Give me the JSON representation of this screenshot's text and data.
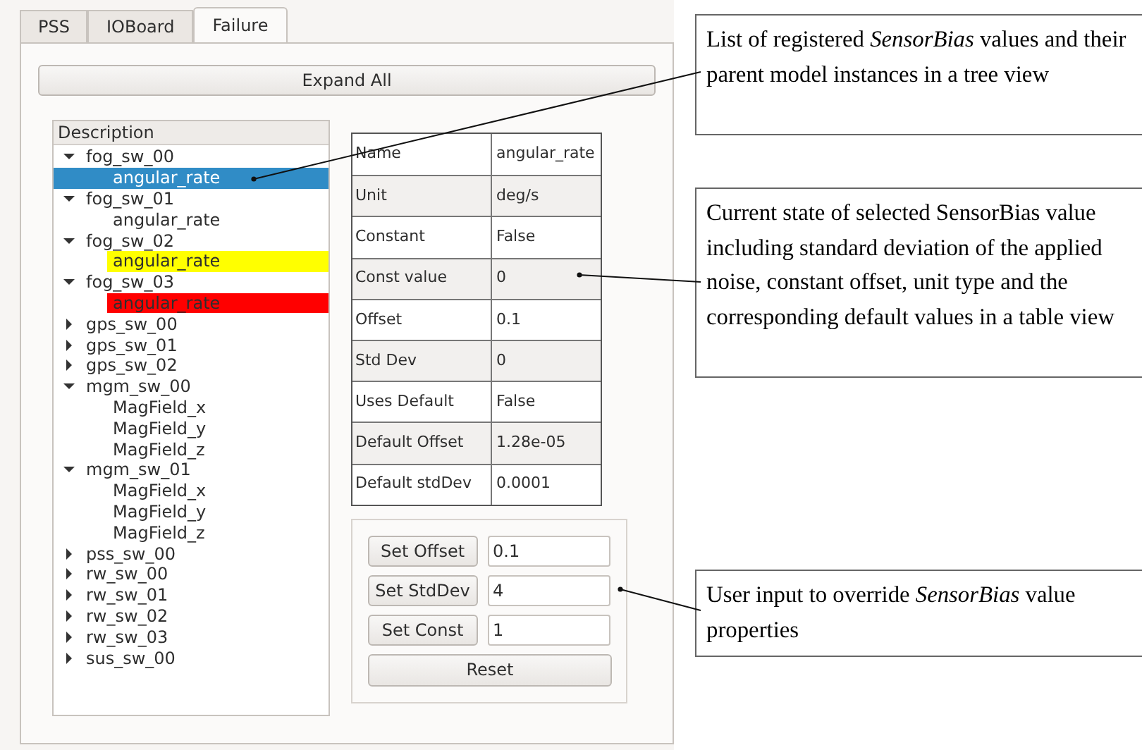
{
  "tabs": [
    {
      "label": "PSS",
      "selected": false
    },
    {
      "label": "IOBoard",
      "selected": false
    },
    {
      "label": "Failure",
      "selected": true
    }
  ],
  "expand_button": "Expand All",
  "tree": {
    "header": "Description",
    "items": [
      {
        "label": "fog_sw_00",
        "expanded": true,
        "selected": false,
        "children": [
          {
            "label": "angular_rate",
            "selected": true
          }
        ]
      },
      {
        "label": "fog_sw_01",
        "expanded": true,
        "selected": false,
        "children": [
          {
            "label": "angular_rate",
            "selected": false
          }
        ]
      },
      {
        "label": "fog_sw_02",
        "expanded": true,
        "selected": false,
        "children": [
          {
            "label": "angular_rate",
            "selected": false,
            "color": "#ffff00"
          }
        ]
      },
      {
        "label": "fog_sw_03",
        "expanded": true,
        "selected": false,
        "children": [
          {
            "label": "angular_rate",
            "selected": false,
            "color": "#ff0000"
          }
        ]
      },
      {
        "label": "gps_sw_00",
        "expanded": false,
        "selected": false
      },
      {
        "label": "gps_sw_01",
        "expanded": false,
        "selected": false
      },
      {
        "label": "gps_sw_02",
        "expanded": false,
        "selected": false
      },
      {
        "label": "mgm_sw_00",
        "expanded": true,
        "selected": false,
        "children": [
          {
            "label": "MagField_x",
            "selected": false
          },
          {
            "label": "MagField_y",
            "selected": false
          },
          {
            "label": "MagField_z",
            "selected": false
          }
        ]
      },
      {
        "label": "mgm_sw_01",
        "expanded": true,
        "selected": false,
        "children": [
          {
            "label": "MagField_x",
            "selected": false
          },
          {
            "label": "MagField_y",
            "selected": false
          },
          {
            "label": "MagField_z",
            "selected": false
          }
        ]
      },
      {
        "label": "pss_sw_00",
        "expanded": false,
        "selected": false
      },
      {
        "label": "rw_sw_00",
        "expanded": false,
        "selected": false
      },
      {
        "label": "rw_sw_01",
        "expanded": false,
        "selected": false
      },
      {
        "label": "rw_sw_02",
        "expanded": false,
        "selected": false
      },
      {
        "label": "rw_sw_03",
        "expanded": false,
        "selected": false
      },
      {
        "label": "sus_sw_00",
        "expanded": false,
        "selected": false
      }
    ]
  },
  "properties": [
    {
      "name": "Name",
      "value": "angular_rate"
    },
    {
      "name": "Unit",
      "value": "deg/s"
    },
    {
      "name": "Constant",
      "value": "False"
    },
    {
      "name": "Const value",
      "value": "0"
    },
    {
      "name": "Offset",
      "value": "0.1"
    },
    {
      "name": "Std Dev",
      "value": "0"
    },
    {
      "name": "Uses Default",
      "value": "False"
    },
    {
      "name": "Default Offset",
      "value": "1.28e-05"
    },
    {
      "name": "Default stdDev",
      "value": "0.0001"
    }
  ],
  "controls": [
    {
      "kind": "setter",
      "button": "Set Offset",
      "value": "0.1"
    },
    {
      "kind": "setter",
      "button": "Set StdDev",
      "value": "4"
    },
    {
      "kind": "setter",
      "button": "Set Const",
      "value": "1"
    },
    {
      "kind": "reset",
      "button": "Reset"
    }
  ],
  "callouts": [
    "List of registered *SensorBias* values and their parent model instances in a tree view",
    "Current state of selected SensorBias value including standard deviation of the applied noise, constant offset, unit type and the corresponding default values in a table view",
    "User input to override *SensorBias* value properties"
  ]
}
